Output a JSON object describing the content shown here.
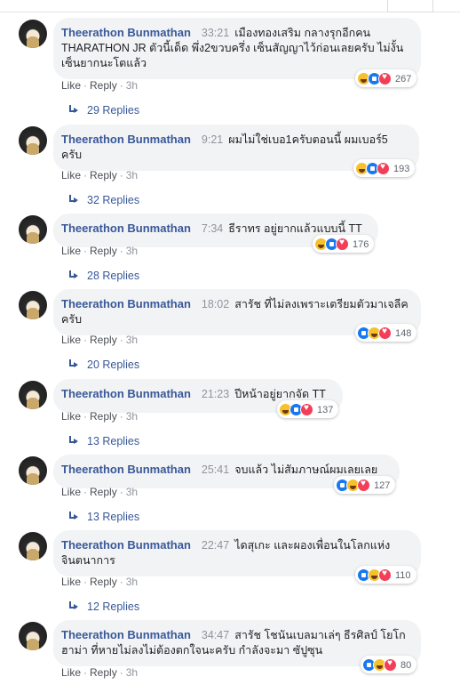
{
  "labels": {
    "like": "Like",
    "reply": "Reply",
    "dot": "·"
  },
  "comments": [
    {
      "name": "Theerathon Bunmathan",
      "time": "33:21",
      "text": "เมืองทองเสริม กลางรุกอีกคน THARATHON JR ตัวนี้เด็ด พึ่ง2ขวบครึ่ง เซ็นสัญญาไว้ก่อนเลยครับ ไม่งั้นเซ็นยากนะโตแล้ว",
      "reactions": [
        "haha",
        "like",
        "love"
      ],
      "count": "267",
      "ago": "3h",
      "replies": "29 Replies"
    },
    {
      "name": "Theerathon Bunmathan",
      "time": "9:21",
      "text": "ผมไม่ใช่เบอ1ครับตอนนี้ ผมเบอร์5 ครับ",
      "reactions": [
        "haha",
        "like",
        "love"
      ],
      "count": "193",
      "ago": "3h",
      "replies": "32 Replies"
    },
    {
      "name": "Theerathon Bunmathan",
      "time": "7:34",
      "text": "ธีราทร อยู่ยากแล้วแบบนี้ TT",
      "reactions": [
        "haha",
        "like",
        "love"
      ],
      "count": "176",
      "ago": "3h",
      "replies": "28 Replies"
    },
    {
      "name": "Theerathon Bunmathan",
      "time": "18:02",
      "text": "สารัช ที่ไม่ลงเพราะเตรียมตัวมาเจลีค ครับ",
      "reactions": [
        "like",
        "haha",
        "love"
      ],
      "count": "148",
      "ago": "3h",
      "replies": "20 Replies"
    },
    {
      "name": "Theerathon Bunmathan",
      "time": "21:23",
      "text": "ปีหน้าอยู่ยากจัด TT",
      "reactions": [
        "haha",
        "like",
        "love"
      ],
      "count": "137",
      "ago": "3h",
      "replies": "13 Replies"
    },
    {
      "name": "Theerathon Bunmathan",
      "time": "25:41",
      "text": "จบแล้ว ไม่สัมภาษณ์ผมเลยเลย",
      "reactions": [
        "like",
        "haha",
        "love"
      ],
      "count": "127",
      "ago": "3h",
      "replies": "13 Replies"
    },
    {
      "name": "Theerathon Bunmathan",
      "time": "22:47",
      "text": "ไดสุเกะ และผองเพื่อนในโลกแห่งจินตนาการ",
      "reactions": [
        "like",
        "haha",
        "love"
      ],
      "count": "110",
      "ago": "3h",
      "replies": "12 Replies"
    },
    {
      "name": "Theerathon Bunmathan",
      "time": "34:47",
      "text": "สารัช โชนันเบลมาเล่ๆ ธีรศิลป์ โยโกฮาม่า ที่หายไม่ลงไม่ต้องตกใจนะครับ กำลังจะมา ซัปูซุน",
      "reactions": [
        "like",
        "haha",
        "love"
      ],
      "count": "80",
      "ago": "3h",
      "replies": ""
    }
  ]
}
